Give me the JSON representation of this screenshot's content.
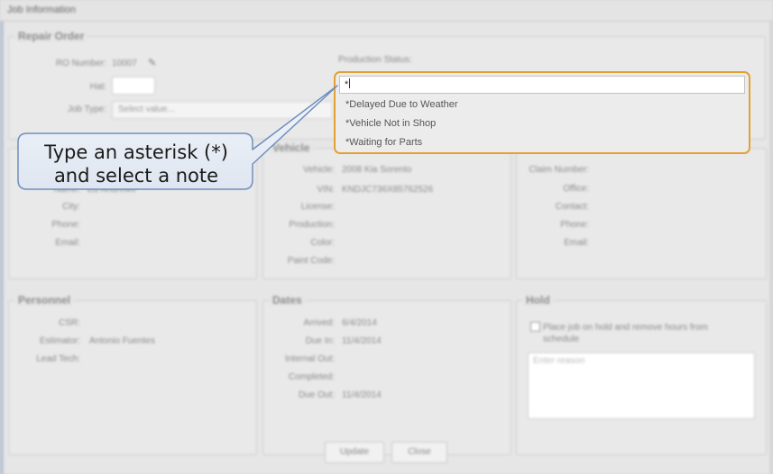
{
  "window": {
    "title": "Job Information"
  },
  "repair_order": {
    "title": "Repair Order",
    "ro_number_label": "RO Number:",
    "ro_number_value": "10007",
    "hat_label": "Hat:",
    "job_type_label": "Job Type:",
    "job_type_value": "Select value..."
  },
  "production_status": {
    "label": "Production Status:",
    "input_value": "*",
    "options": [
      "*Delayed Due to Weather",
      "*Vehicle Not in Shop",
      "*Waiting for Parts"
    ]
  },
  "customer": {
    "name_label": "Name:",
    "name_value": "Ed Andrews",
    "city_label": "City:",
    "phone_label": "Phone:",
    "email_label": "Email:"
  },
  "vehicle": {
    "title": "Vehicle",
    "vehicle_label": "Vehicle:",
    "vehicle_value": "2008 Kia Sorento",
    "vin_label": "VIN:",
    "vin_value": "KNDJC736X85762526",
    "license_label": "License:",
    "production_label": "Production:",
    "color_label": "Color:",
    "paint_code_label": "Paint Code:"
  },
  "insurance": {
    "claim_number_label": "Claim Number:",
    "office_label": "Office:",
    "contact_label": "Contact:",
    "phone_label": "Phone:",
    "email_label": "Email:"
  },
  "personnel": {
    "title": "Personnel",
    "csr_label": "CSR:",
    "estimator_label": "Estimator:",
    "estimator_value": "Antonio Fuentes",
    "lead_tech_label": "Lead Tech:"
  },
  "dates": {
    "title": "Dates",
    "arrived_label": "Arrived:",
    "arrived_value": "6/4/2014",
    "due_in_label": "Due In:",
    "due_in_value": "11/4/2014",
    "internal_out_label": "Internal Out:",
    "completed_label": "Completed:",
    "due_out_label": "Due Out:",
    "due_out_value": "11/4/2014"
  },
  "hold": {
    "title": "Hold",
    "checkbox_label": "Place job on hold and remove hours from schedule",
    "reason_placeholder": "Enter reason"
  },
  "buttons": {
    "update": "Update",
    "close": "Close"
  },
  "callout": {
    "line1": "Type an asterisk (*)",
    "line2": "and select a note"
  },
  "colors": {
    "highlight_border": "#e2a133",
    "callout_border": "#6f8fbd",
    "callout_fill": "#e9eef6"
  }
}
